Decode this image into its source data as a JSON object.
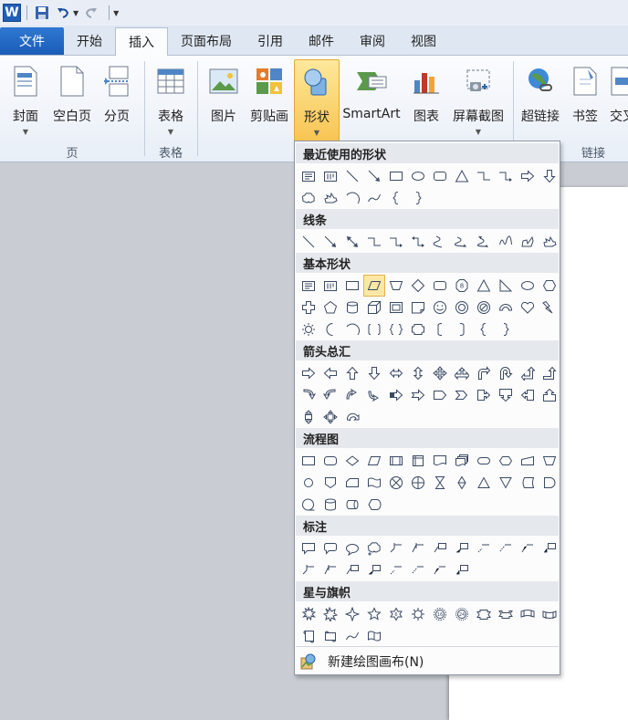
{
  "qat": {
    "app_letter": "W"
  },
  "tabs": {
    "file": "文件",
    "items": [
      "开始",
      "插入",
      "页面布局",
      "引用",
      "邮件",
      "审阅",
      "视图"
    ],
    "active": "插入"
  },
  "ribbon": {
    "buttons": [
      "封面",
      "空白页",
      "分页",
      "表格",
      "图片",
      "剪贴画",
      "形状",
      "SmartArt",
      "图表",
      "屏幕截图",
      "超链接",
      "书签",
      "交叉"
    ],
    "groups": [
      "页",
      "表格",
      "链接"
    ]
  },
  "shapes_menu": {
    "sections": [
      {
        "title": "最近使用的形状",
        "rows": [
          [
            "textbox",
            "vtextbox",
            "line",
            "arrow",
            "rect",
            "oval",
            "rrect",
            "triangle",
            "elbow",
            "elbowarrow",
            "rarrow",
            "darrow"
          ],
          [
            "callout-cloud",
            "freeform",
            "arc",
            "wave",
            "lbrace",
            "rbrace"
          ]
        ]
      },
      {
        "title": "线条",
        "rows": [
          [
            "line",
            "arrow",
            "dblarrow",
            "elbow",
            "elbowarrow",
            "elbowdbl",
            "curve",
            "curvearrow",
            "curvedbl",
            "scribble",
            "freeform2",
            "freeform"
          ]
        ]
      },
      {
        "title": "基本形状",
        "rows": [
          [
            "textbox",
            "vtextbox",
            "rect",
            "parallelogram",
            "trapezoid",
            "diamond",
            "rrect",
            "octagon",
            "triangle",
            "rtriangle",
            "oval",
            "hexagon"
          ],
          [
            "cross",
            "pentagon",
            "can",
            "cube",
            "bevel",
            "foldedcorner",
            "smiley",
            "donut",
            "noSymbol",
            "blockarc",
            "heart",
            "lightning"
          ],
          [
            "sun",
            "moon",
            "arc",
            "brackets",
            "braces",
            "plaque",
            "lbracket",
            "rbracket",
            "lbrace",
            "rbrace"
          ]
        ]
      },
      {
        "title": "箭头总汇",
        "rows": [
          [
            "rarrow",
            "larrow",
            "uarrow",
            "darrow",
            "lrarrow",
            "udarrow",
            "quadarrow",
            "lrUarrow",
            "bentarrow",
            "uturn",
            "luarrow",
            "bentuparrow"
          ],
          [
            "curvedR",
            "curvedL",
            "curvedU",
            "curvedD",
            "stripedR",
            "notchedR",
            "pentagonA",
            "chevron",
            "rarrowcallout",
            "darrowcallout",
            "larrowcallout",
            "uarrowcallout"
          ],
          [
            "udarrowcallout",
            "quadcallout",
            "circulararrow"
          ]
        ]
      },
      {
        "title": "流程图",
        "rows": [
          [
            "fc-process",
            "fc-alt",
            "fc-decision",
            "fc-data",
            "fc-predef",
            "fc-internal",
            "fc-document",
            "fc-multidoc",
            "fc-terminator",
            "fc-prep",
            "fc-manualinput",
            "fc-manualop"
          ],
          [
            "fc-connector",
            "fc-offpage",
            "fc-card",
            "fc-tape",
            "fc-sumjunction",
            "fc-or",
            "fc-collate",
            "fc-sort",
            "fc-extract",
            "fc-merge",
            "fc-stored",
            "fc-delay"
          ],
          [
            "fc-seqaccess",
            "fc-magdisk",
            "fc-direct",
            "fc-display"
          ]
        ]
      },
      {
        "title": "标注",
        "rows": [
          [
            "callout-rect",
            "callout-rrect",
            "callout-oval",
            "callout-cloud2",
            "line-callout1",
            "line-callout2",
            "line-callout3",
            "line-callout4",
            "line-callout5",
            "line-callout6",
            "line-callout7",
            "line-callout8"
          ],
          [
            "line-callout9",
            "line-callout10",
            "line-callout11",
            "line-callout12",
            "line-callout13",
            "line-callout14",
            "line-callout15",
            "line-callout16"
          ]
        ]
      },
      {
        "title": "星与旗帜",
        "rows": [
          [
            "explosion1",
            "explosion2",
            "star4",
            "star5",
            "star6",
            "star8",
            "star16",
            "star24",
            "ribbon-down",
            "ribbon-up",
            "ribbon-curved-down",
            "ribbon-curved-up"
          ],
          [
            "vscroll",
            "hscroll",
            "wave",
            "doublewave"
          ]
        ]
      }
    ],
    "new_canvas": "新建绘图画布(N)"
  },
  "colors": {
    "accent": "#1f5fb8",
    "highlight": "#f8c553",
    "shape_stroke": "#3b4a63"
  }
}
